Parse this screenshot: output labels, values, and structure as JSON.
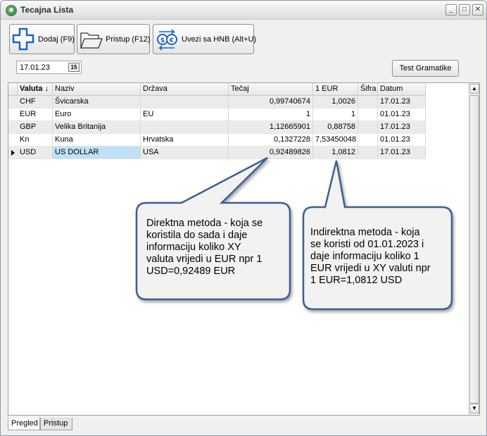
{
  "window": {
    "title": "Tecajna Lista",
    "controls": [
      "_",
      "□",
      "✕"
    ]
  },
  "toolbar": {
    "add_label": "Dodaj (F9)",
    "open_label": "Pristup (F12)",
    "import_label": "Uvezi sa HNB (Alt+U)"
  },
  "filter": {
    "date_value": "17.01.23",
    "date_picker_glyph": "15",
    "test_button_label": "Test Gramatike"
  },
  "grid": {
    "columns": [
      "Valuta ↓",
      "Naziv",
      "Država",
      "Tečaj",
      "1 EUR",
      "Šifra",
      "Datum"
    ],
    "rows": [
      {
        "valuta": "CHF",
        "naziv": "Švicarska",
        "drzava": "",
        "tecaj": "0,99740674",
        "eur": "1,0026",
        "sifra": "",
        "datum": "17.01.23"
      },
      {
        "valuta": "EUR",
        "naziv": "Euro",
        "drzava": "EU",
        "tecaj": "1",
        "eur": "1",
        "sifra": "",
        "datum": "01.01.23"
      },
      {
        "valuta": "GBP",
        "naziv": "Velika Britanija",
        "drzava": "",
        "tecaj": "1,12665901",
        "eur": "0,88758",
        "sifra": "",
        "datum": "17.01.23"
      },
      {
        "valuta": "Kn",
        "naziv": "Kuna",
        "drzava": "Hrvatska",
        "tecaj": "0,1327228",
        "eur": "7,53450048",
        "sifra": "",
        "datum": "01.01.23"
      },
      {
        "valuta": "USD",
        "naziv": "US DOLLAR",
        "drzava": "USA",
        "tecaj": "0,92489826",
        "eur": "1,0812",
        "sifra": "",
        "datum": "17.01.23"
      }
    ],
    "current_row": 4
  },
  "tabs": [
    "Pregled",
    "Pristup"
  ],
  "callouts": {
    "direct": [
      "Direktna metoda - koja se",
      "koristila do sada i daje",
      "informaciju koliko XY",
      "valuta vrijedi u EUR npr 1",
      "USD=0,92489 EUR"
    ],
    "indirect": [
      "Indirektna metoda - koja",
      "se koristi od 01.01.2023 i",
      "daje informaciju koliko 1",
      "EUR vrijedi u XY valuti npr",
      "1 EUR=1,0812 USD"
    ]
  },
  "colors": {
    "callout_fill": "#f2f2f2",
    "callout_border": "#3c5f91",
    "selected_cell": "#bfe0f5",
    "icon_blue": "#1a64c4"
  }
}
